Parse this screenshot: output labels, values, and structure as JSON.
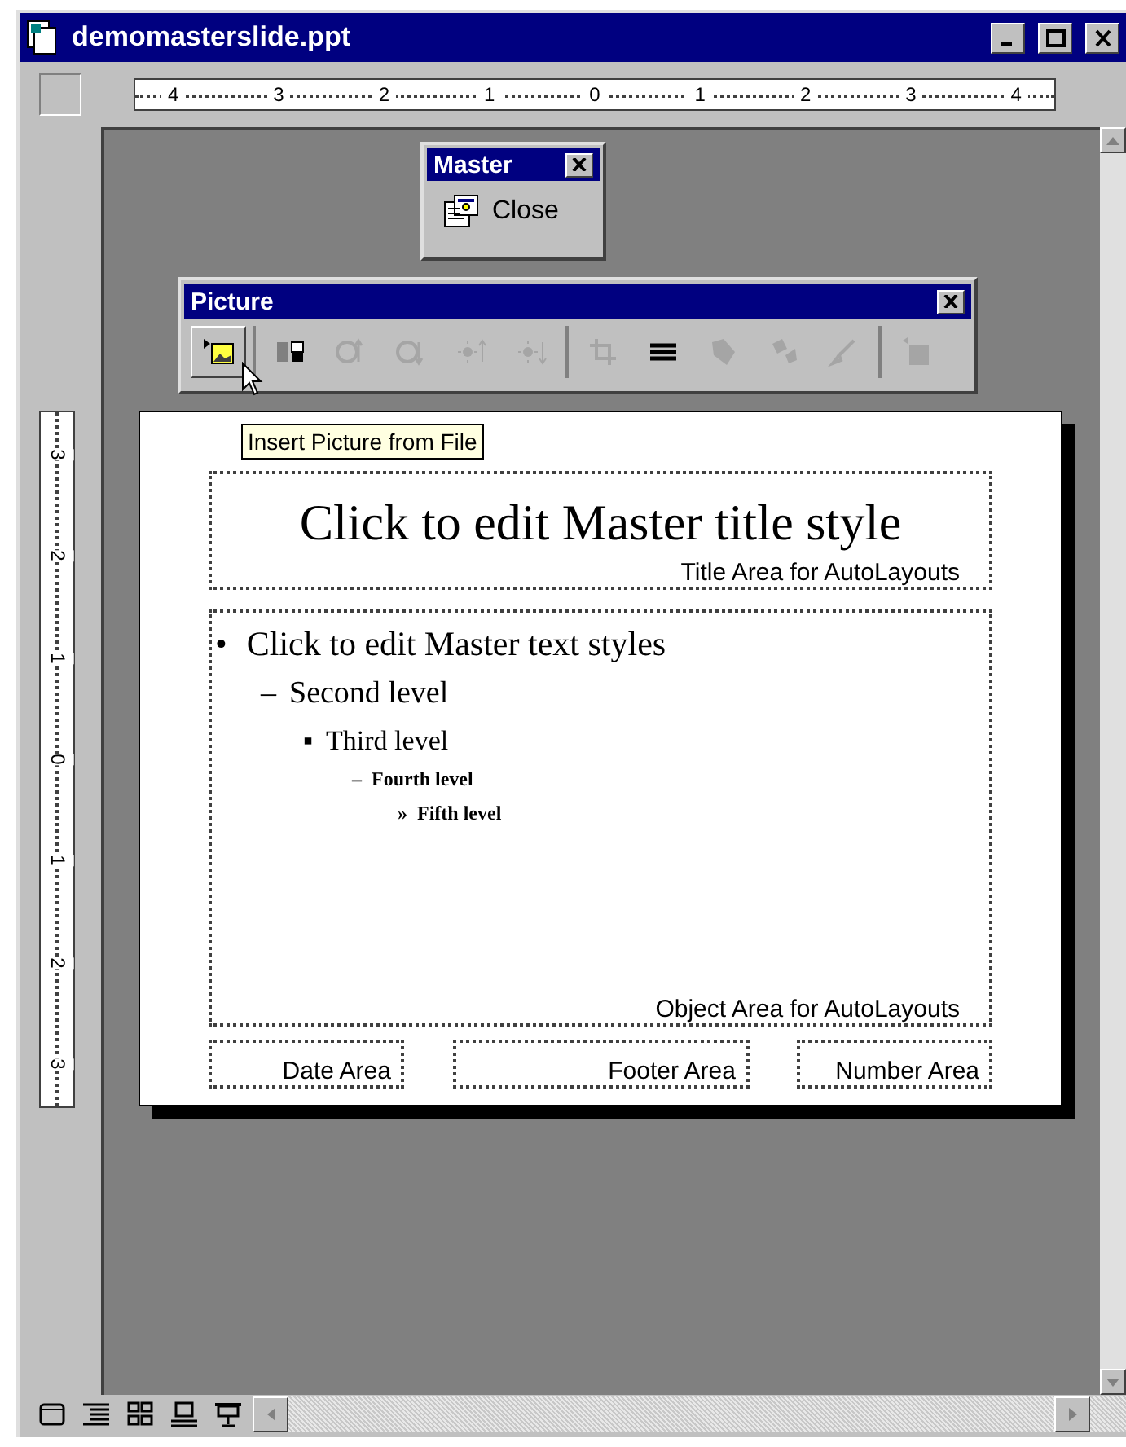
{
  "window": {
    "title": "demomasterslide.ppt"
  },
  "horizontal_ruler": [
    "4",
    "3",
    "2",
    "1",
    "0",
    "1",
    "2",
    "3",
    "4"
  ],
  "vertical_ruler": [
    "3",
    "2",
    "1",
    "0",
    "1",
    "2",
    "3"
  ],
  "master_toolbar": {
    "title": "Master",
    "button": "Close"
  },
  "picture_toolbar": {
    "title": "Picture",
    "groups": [
      [
        {
          "disabled": false,
          "pressed": true
        }
      ],
      [
        {
          "disabled": false,
          "pressed": false
        },
        {
          "disabled": true,
          "pressed": false
        },
        {
          "disabled": true,
          "pressed": false
        },
        {
          "disabled": true,
          "pressed": false
        },
        {
          "disabled": true,
          "pressed": false
        }
      ],
      [
        {
          "disabled": true,
          "pressed": false
        },
        {
          "disabled": false,
          "pressed": false
        },
        {
          "disabled": true,
          "pressed": false
        },
        {
          "disabled": true,
          "pressed": false
        },
        {
          "disabled": true,
          "pressed": false
        }
      ],
      [
        {
          "disabled": true,
          "pressed": false
        }
      ]
    ]
  },
  "tooltip": "Insert Picture from File",
  "slide": {
    "title": "Click to edit Master title style",
    "title_area_label": "Title Area for AutoLayouts",
    "body_levels": [
      {
        "bullet": "•",
        "text": "Click to edit Master text styles"
      },
      {
        "bullet": "–",
        "text": "Second level"
      },
      {
        "bullet": "▪",
        "text": "Third level"
      },
      {
        "bullet": "–",
        "text": "Fourth level"
      },
      {
        "bullet": "»",
        "text": "Fifth level"
      }
    ],
    "object_area_label": "Object Area for AutoLayouts",
    "footer_areas": [
      "Date Area",
      "Footer Area",
      "Number Area"
    ]
  }
}
